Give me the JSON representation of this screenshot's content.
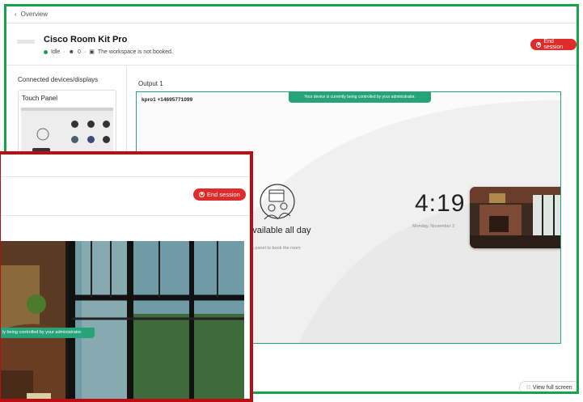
{
  "header": {
    "back_label": "Overview",
    "device_name": "Cisco Room Kit Pro",
    "status": "Idle",
    "people_count": "0",
    "booking_text": "The workspace is not booked.",
    "end_session_label": "End session"
  },
  "sidebar": {
    "title": "Connected devices/displays",
    "panel_label": "Touch Panel"
  },
  "output": {
    "label": "Output 1",
    "banner": "Your device is currently being controlled by your administrator.",
    "call_id": "kpro1 +14695771099",
    "time": "4:19",
    "date": "Monday, November 2",
    "availability": "n available all day",
    "tap_hint": "uch panel to book the room"
  },
  "footer": {
    "view_full_screen": "View full screen"
  },
  "zoom": {
    "end_session_label": "End session",
    "banner": "ly being controlled by your administrator."
  },
  "colors": {
    "accent_green": "#17a34a",
    "end_red": "#e02b2b",
    "banner_green": "#27a37a",
    "zoom_frame_red": "#bc0d12"
  }
}
